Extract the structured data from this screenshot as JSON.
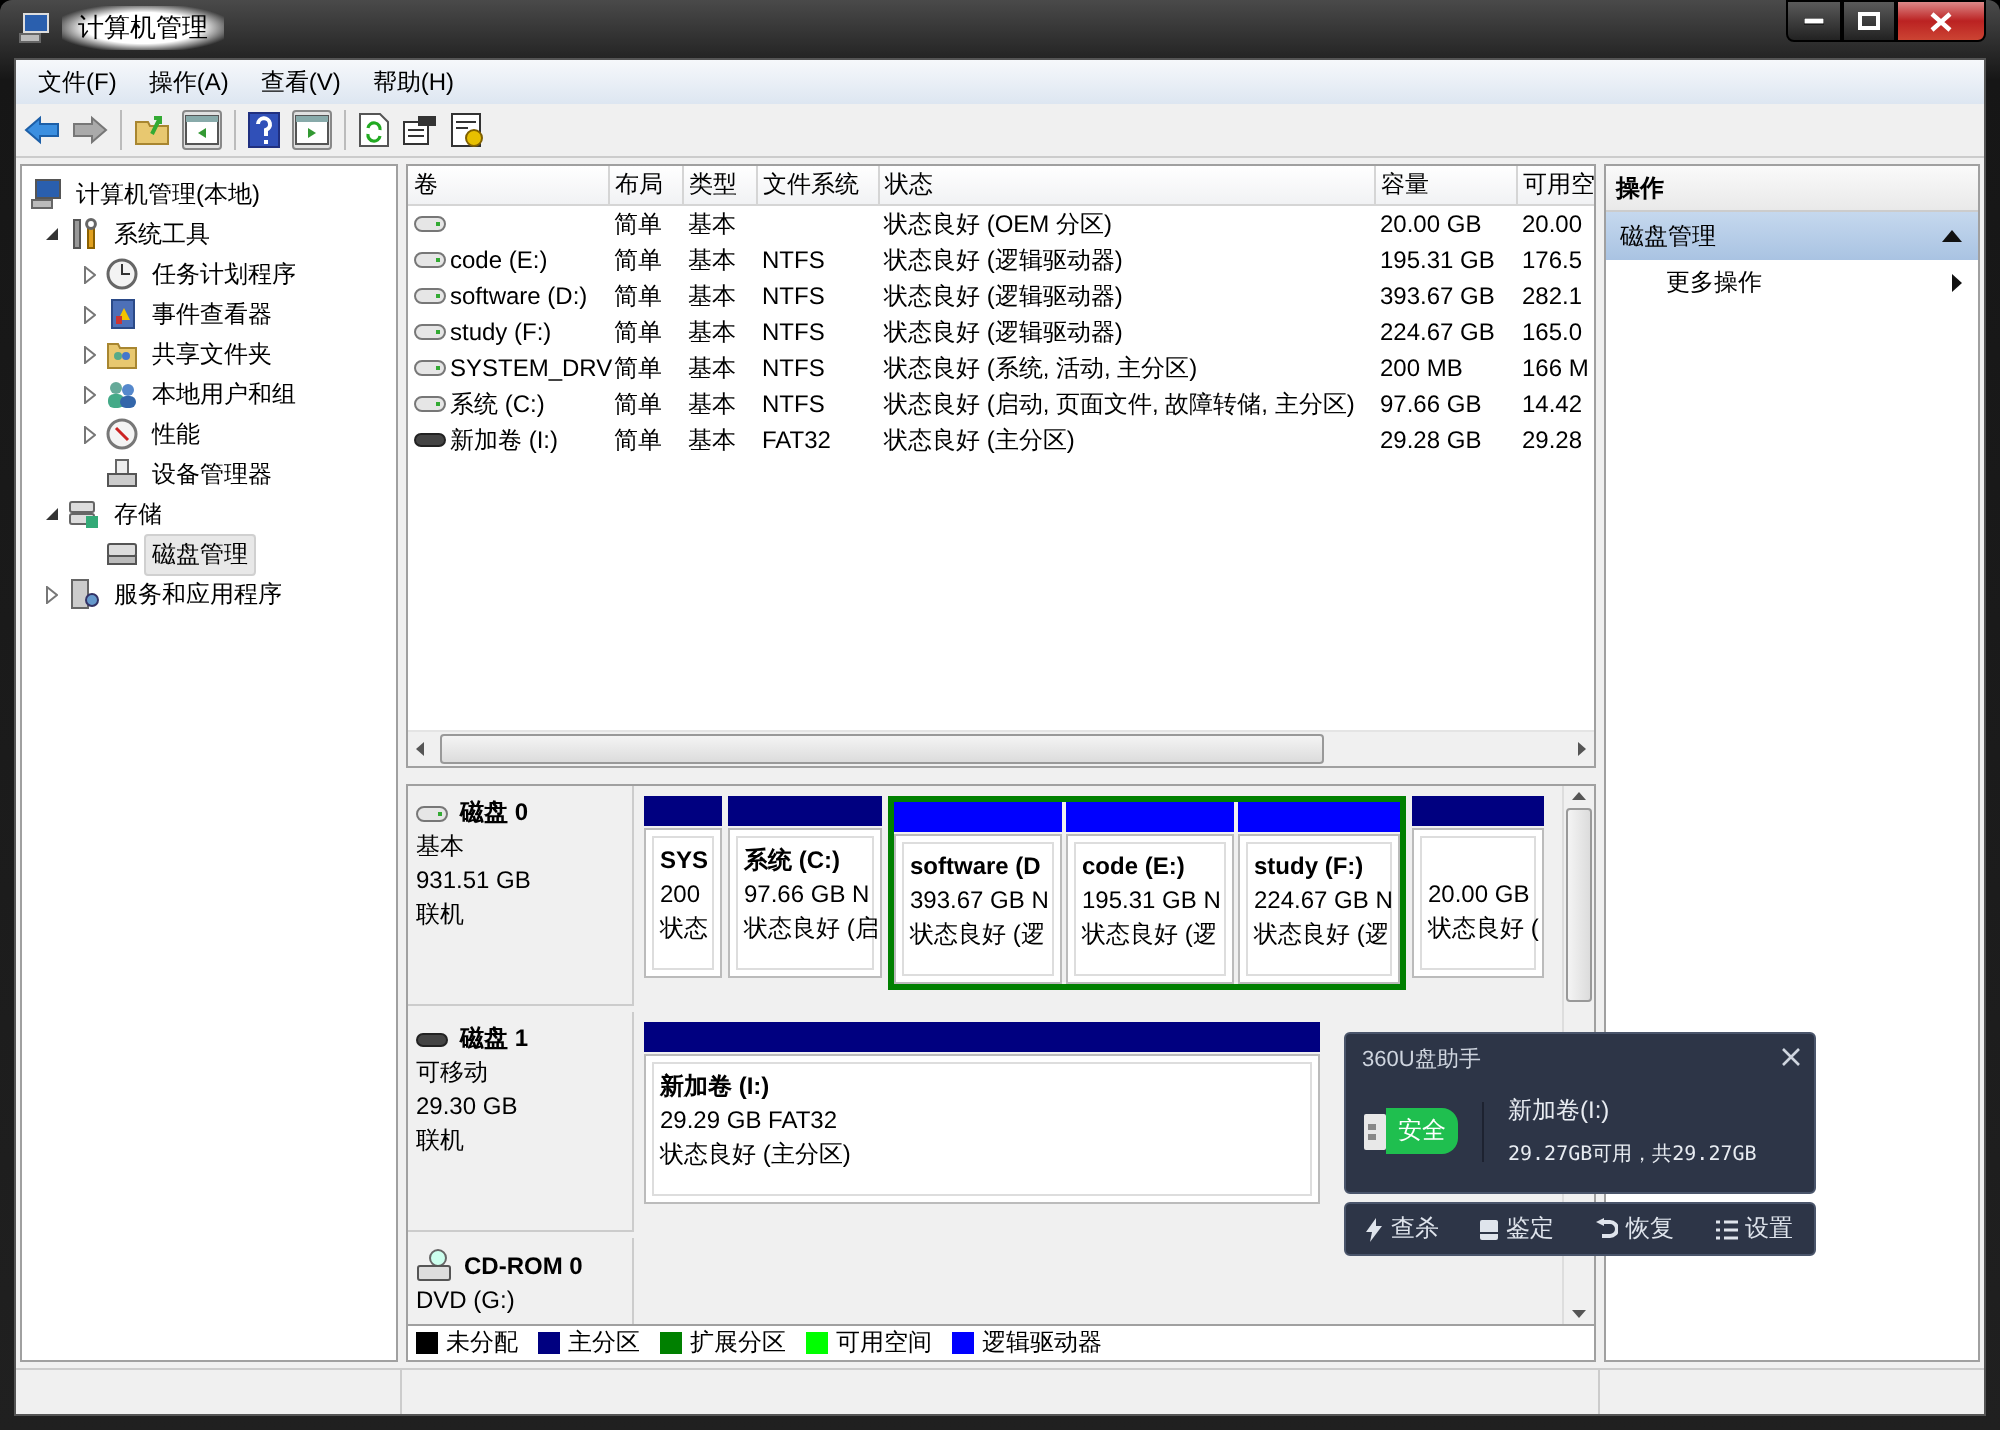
{
  "window": {
    "title": "计算机管理"
  },
  "menu": [
    "文件(F)",
    "操作(A)",
    "查看(V)",
    "帮助(H)"
  ],
  "tree": [
    {
      "label": "计算机管理(本地)",
      "kind": "computer",
      "selected": false,
      "children": [
        {
          "label": "系统工具",
          "kind": "tools",
          "expanded": true,
          "selected": false,
          "children": [
            {
              "label": "任务计划程序",
              "kind": "clock",
              "expanded": false,
              "selected": false
            },
            {
              "label": "事件查看器",
              "kind": "log",
              "expanded": false,
              "selected": false
            },
            {
              "label": "共享文件夹",
              "kind": "share",
              "expanded": false,
              "selected": false
            },
            {
              "label": "本地用户和组",
              "kind": "users",
              "expanded": false,
              "selected": false
            },
            {
              "label": "性能",
              "kind": "perf",
              "expanded": false,
              "selected": false
            },
            {
              "label": "设备管理器",
              "kind": "device",
              "selected": false
            }
          ]
        },
        {
          "label": "存储",
          "kind": "storage",
          "expanded": true,
          "selected": false,
          "children": [
            {
              "label": "磁盘管理",
              "kind": "disk",
              "selected": true
            }
          ]
        },
        {
          "label": "服务和应用程序",
          "kind": "services",
          "expanded": false,
          "selected": false
        }
      ]
    }
  ],
  "table": {
    "columns": [
      "卷",
      "布局",
      "类型",
      "文件系统",
      "状态",
      "容量",
      "可用空"
    ],
    "rows": [
      {
        "kind": "disk",
        "layout": "简单",
        "type": "基本",
        "status": "状态良好 (OEM 分区)",
        "capacity": "20.00 GB",
        "free": "20.00"
      },
      {
        "kind": "disk",
        "volume": "code (E:)",
        "layout": "简单",
        "type": "基本",
        "fs": "NTFS",
        "status": "状态良好 (逻辑驱动器)",
        "capacity": "195.31 GB",
        "free": "176.5"
      },
      {
        "kind": "disk",
        "volume": "software (D:)",
        "layout": "简单",
        "type": "基本",
        "fs": "NTFS",
        "status": "状态良好 (逻辑驱动器)",
        "capacity": "393.67 GB",
        "free": "282.1"
      },
      {
        "kind": "disk",
        "volume": "study (F:)",
        "layout": "简单",
        "type": "基本",
        "fs": "NTFS",
        "status": "状态良好 (逻辑驱动器)",
        "capacity": "224.67 GB",
        "free": "165.0"
      },
      {
        "kind": "disk",
        "volume": "SYSTEM_DRV",
        "layout": "简单",
        "type": "基本",
        "fs": "NTFS",
        "status": "状态良好 (系统, 活动, 主分区)",
        "capacity": "200 MB",
        "free": "166 M"
      },
      {
        "kind": "disk",
        "volume": "系统 (C:)",
        "layout": "简单",
        "type": "基本",
        "fs": "NTFS",
        "status": "状态良好 (启动, 页面文件, 故障转储, 主分区)",
        "capacity": "97.66 GB",
        "free": "14.42"
      },
      {
        "kind": "removable",
        "volume": "新加卷 (I:)",
        "layout": "简单",
        "type": "基本",
        "fs": "FAT32",
        "status": "状态良好 (主分区)",
        "capacity": "29.28 GB",
        "free": "29.28"
      }
    ]
  },
  "disks": [
    {
      "kind": "disk",
      "name": "磁盘 0",
      "type": "基本",
      "size": "931.51 GB",
      "status": "联机",
      "partitions": [
        {
          "kind": "primary",
          "label": "SYS",
          "size": "200",
          "status": "状态"
        },
        {
          "kind": "primary",
          "label": "系统  (C:)",
          "size": "97.66 GB N",
          "status": "状态良好 (启"
        },
        {
          "kind": "extended",
          "children": [
            {
              "kind": "logical",
              "label": "software  (D",
              "size": "393.67 GB N",
              "status": "状态良好 (逻"
            },
            {
              "kind": "logical",
              "label": "code  (E:)",
              "size": "195.31 GB N",
              "status": "状态良好 (逻"
            },
            {
              "kind": "logical",
              "label": "study  (F:)",
              "size": "224.67 GB N",
              "status": "状态良好 (逻"
            }
          ]
        },
        {
          "kind": "primary",
          "size": "20.00 GB",
          "status": "状态良好 ("
        }
      ]
    },
    {
      "kind": "removable",
      "name": "磁盘 1",
      "type": "可移动",
      "size": "29.30 GB",
      "status": "联机",
      "partitions": [
        {
          "kind": "primary",
          "label": "新加卷  (I:)",
          "size": "29.29 GB FAT32",
          "status": "状态良好 (主分区)"
        }
      ]
    },
    {
      "kind": "cdrom",
      "name": "CD-ROM 0",
      "type": "DVD (G:)"
    }
  ],
  "legend": [
    {
      "label": "未分配",
      "color": "#000000"
    },
    {
      "label": "主分区",
      "color": "#000080"
    },
    {
      "label": "扩展分区",
      "color": "#008000"
    },
    {
      "label": "可用空间",
      "color": "#00ff00"
    },
    {
      "label": "逻辑驱动器",
      "color": "#0000ff"
    }
  ],
  "actions": {
    "title": "操作",
    "sections": [
      {
        "label": "磁盘管理",
        "expanded": true,
        "items": [
          "更多操作"
        ]
      }
    ]
  },
  "popup": {
    "title": "360U盘助手",
    "badge": "安全",
    "volume": "新加卷(I:)",
    "info": "29.27GB可用，共29.27GB",
    "actions": [
      {
        "kind": "scan",
        "label": "查杀"
      },
      {
        "kind": "identify",
        "label": "鉴定"
      },
      {
        "kind": "restore",
        "label": "恢复"
      },
      {
        "kind": "settings",
        "label": "设置"
      }
    ]
  }
}
